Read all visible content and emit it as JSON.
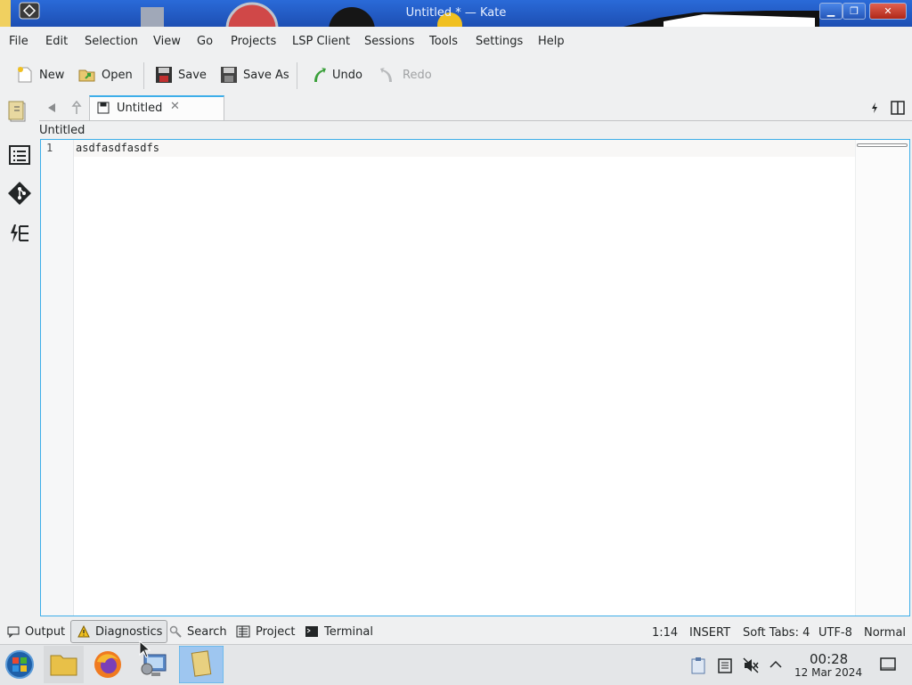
{
  "window": {
    "title": "Untitled * — Kate",
    "controls": [
      "minimize-icon",
      "maximize-icon",
      "close-icon"
    ]
  },
  "menubar": {
    "items": [
      "File",
      "Edit",
      "Selection",
      "View",
      "Go",
      "Projects",
      "LSP Client",
      "Sessions",
      "Tools",
      "Settings",
      "Help"
    ]
  },
  "toolbar": {
    "new_label": "New",
    "open_label": "Open",
    "save_label": "Save",
    "saveas_label": "Save As",
    "undo_label": "Undo",
    "redo_label": "Redo"
  },
  "tabs": {
    "active_label": "Untitled",
    "breadcrumb": "Untitled"
  },
  "editor": {
    "line_numbers": [
      "1"
    ],
    "lines": [
      "asdfasdfasdfs"
    ]
  },
  "bottom_panels": {
    "output": "Output",
    "diagnostics": "Diagnostics",
    "search": "Search",
    "project": "Project",
    "terminal": "Terminal"
  },
  "statusbar": {
    "cursor": "1:14",
    "mode": "INSERT",
    "indent": "Soft Tabs: 4",
    "encoding": "UTF-8",
    "input_mode": "Normal"
  },
  "taskbar": {
    "time": "00:28",
    "date": "12 Mar 2024"
  },
  "colors": {
    "accent": "#3daee9",
    "titlebar": "#2a6ad8",
    "background": "#eff0f1"
  }
}
